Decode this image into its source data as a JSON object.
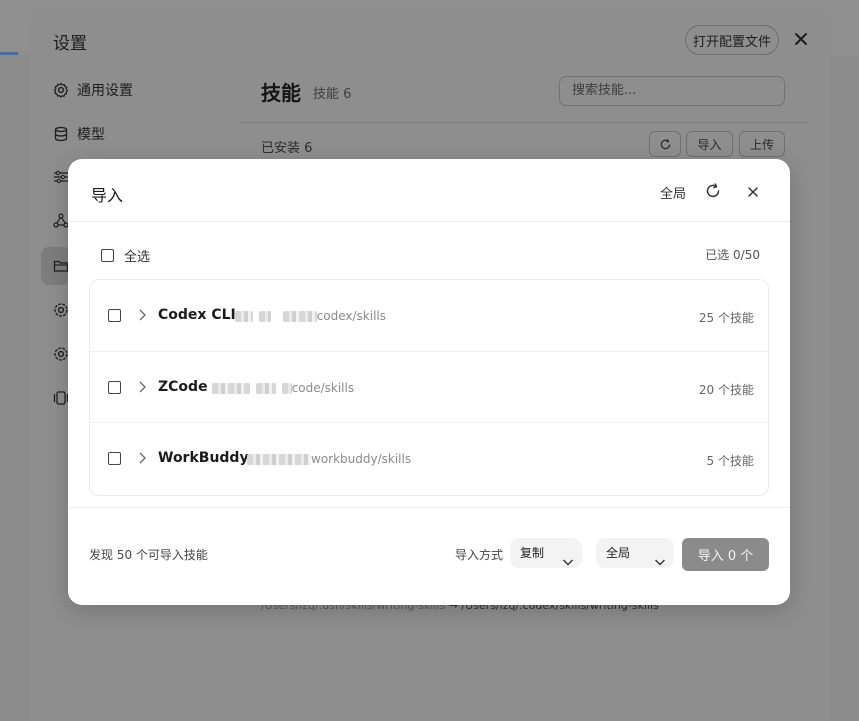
{
  "settings": {
    "title": "设置",
    "open_config_label": "打开配置文件",
    "sidebar": [
      {
        "label": "通用设置",
        "icon": "gear-icon"
      },
      {
        "label": "模型",
        "icon": "database-icon"
      }
    ],
    "sidebar_icons_only": [
      "sliders-icon",
      "network-icon",
      "folder-icon",
      "gear-icon",
      "gear-icon",
      "panels-icon"
    ],
    "skills_title": "技能",
    "skills_count": "技能 6",
    "search_placeholder": "搜索技能...",
    "installed_label": "已安装 6",
    "actions": {
      "import": "导入",
      "upload": "上传"
    },
    "path_from": "/Users/lzq/.dsh/skills/writing-skills",
    "path_to": "→ /Users/lzq/.codex/skills/writing-skills"
  },
  "modal": {
    "title": "导入",
    "scope_label": "全局",
    "select_all_label": "全选",
    "selected_count": "已选 0/50",
    "sources": [
      {
        "name": "Codex CLI",
        "path": "codex/skills",
        "count": "25 个技能"
      },
      {
        "name": "ZCode",
        "path": "code/skills",
        "count": "20 个技能"
      },
      {
        "name": "WorkBuddy",
        "path": "workbuddy/skills",
        "count": "5 个技能"
      }
    ],
    "footer": {
      "found_text": "发现 50 个可导入技能",
      "method_label": "导入方式",
      "method_value": "复制",
      "scope_value": "全局",
      "import_button": "导入 0 个"
    }
  }
}
